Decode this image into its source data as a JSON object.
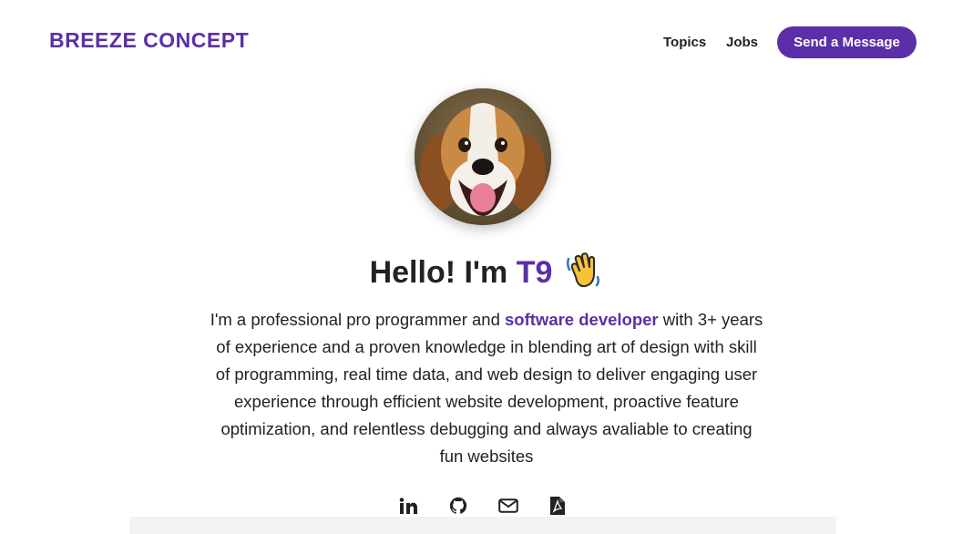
{
  "nav": {
    "brand": "BREEZE CONCEPT",
    "links": [
      {
        "label": "Topics"
      },
      {
        "label": "Jobs"
      }
    ],
    "cta_label": "Send a Message"
  },
  "hero": {
    "greeting": "Hello! I'm ",
    "name": "T9",
    "wave_icon": "waving-hand-icon",
    "avatar_icon": "beagle-dog-photo"
  },
  "bio": {
    "before": "I'm a professional pro programmer and ",
    "highlight": "software developer",
    "after": " with 3+ years of experience and a proven knowledge in blending art of design with skill of programming, real time data, and web design to deliver engaging user experience through efficient website development, proactive feature optimization, and relentless debugging and always avaliable to creating fun websites"
  },
  "social": [
    {
      "icon": "linkedin-icon"
    },
    {
      "icon": "github-icon"
    },
    {
      "icon": "mail-icon"
    },
    {
      "icon": "pdf-icon"
    }
  ],
  "colors": {
    "accent": "#5b2fa8",
    "text": "#222222",
    "background": "#ffffff"
  }
}
